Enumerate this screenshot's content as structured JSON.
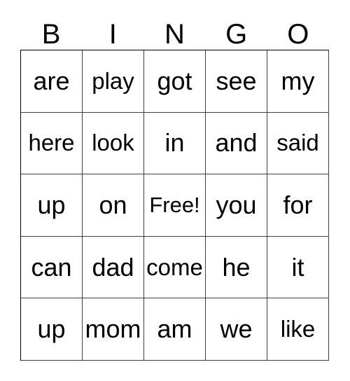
{
  "card": {
    "headers": [
      "B",
      "I",
      "N",
      "G",
      "O"
    ],
    "rows": [
      [
        "are",
        "play",
        "got",
        "see",
        "my"
      ],
      [
        "here",
        "look",
        "in",
        "and",
        "said"
      ],
      [
        "up",
        "on",
        "Free!",
        "you",
        "for"
      ],
      [
        "can",
        "dad",
        "come",
        "he",
        "it"
      ],
      [
        "up",
        "mom",
        "am",
        "we",
        "like"
      ]
    ],
    "free_space": "Free!",
    "colors": {
      "background": "#ffffff",
      "text": "#000000",
      "grid_line": "#3f3f3f",
      "outer_border": "#000000"
    }
  }
}
